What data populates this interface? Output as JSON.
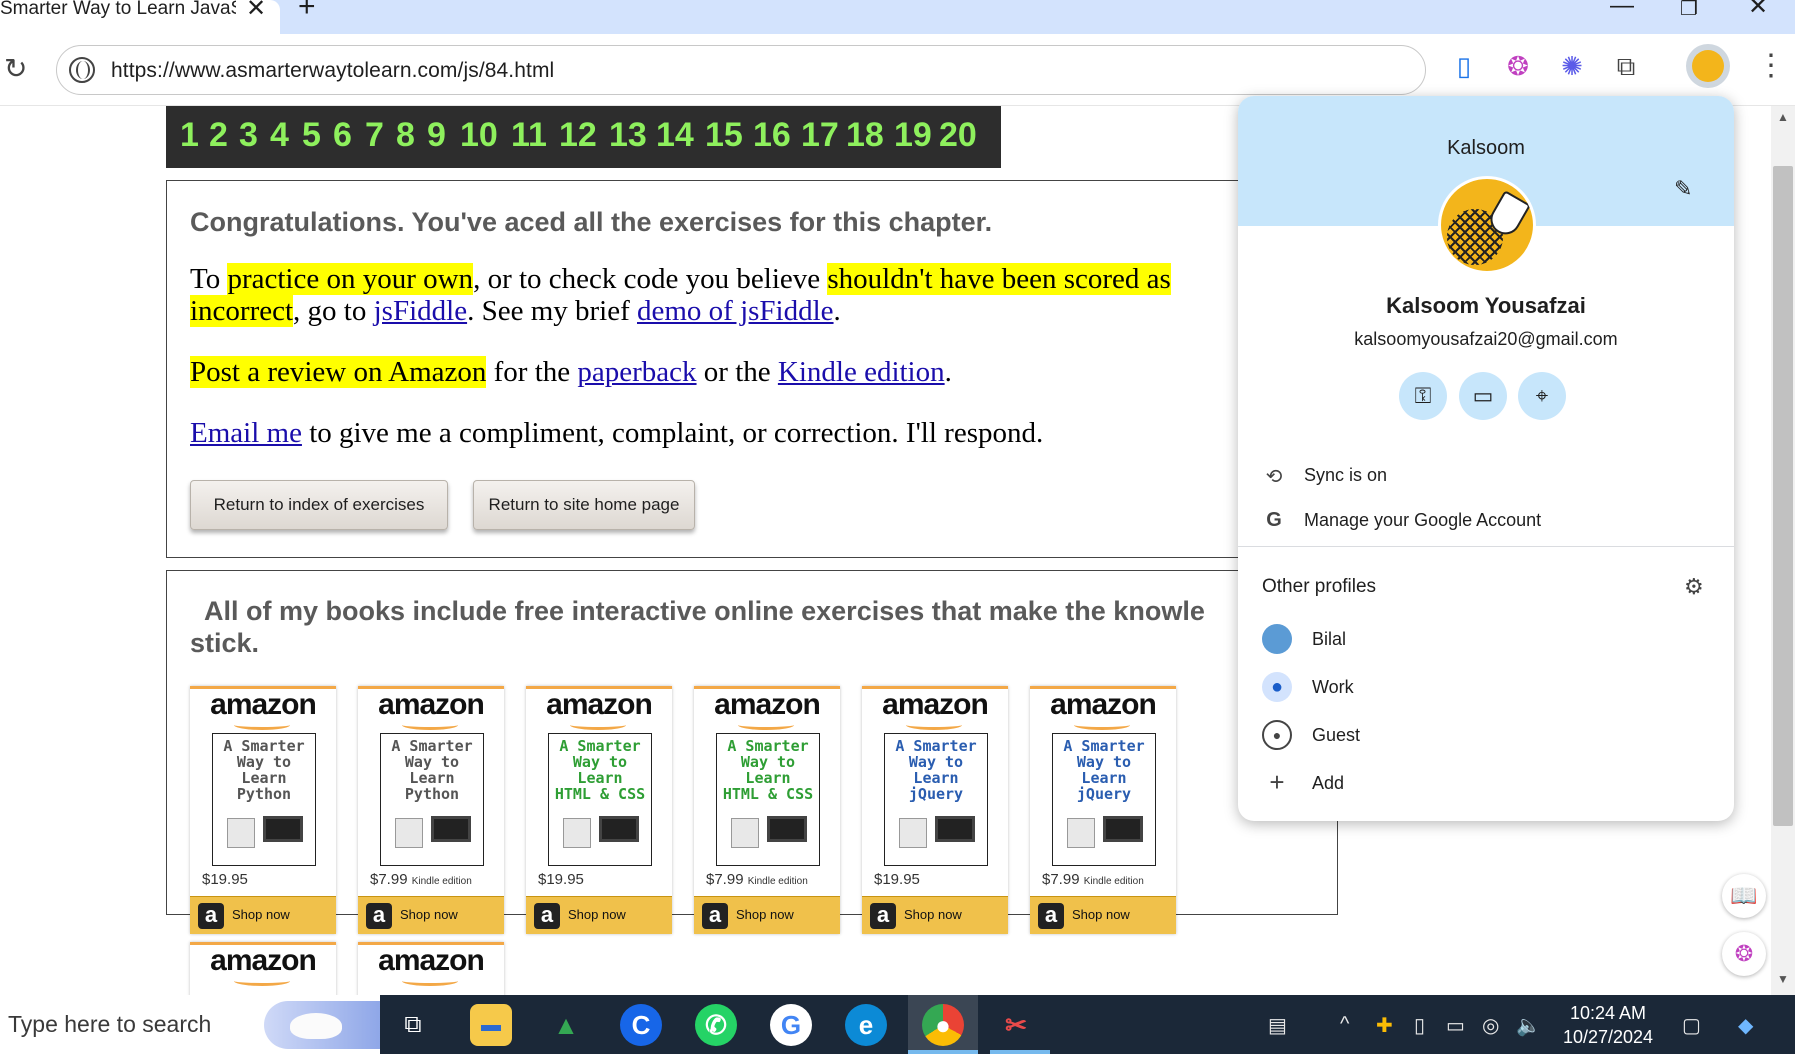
{
  "browser": {
    "tab_title": "Smarter Way to Learn JavaScr",
    "url": "https://www.asmarterwaytolearn.com/js/84.html"
  },
  "page": {
    "nav_numbers": [
      "1",
      "2",
      "3",
      "4",
      "5",
      "6",
      "7",
      "8",
      "9",
      "10",
      "11",
      "12",
      "13",
      "14",
      "15",
      "16",
      "17",
      "18",
      "19",
      "20"
    ],
    "congrats": "Congratulations. You've aced all the exercises for this chapter.",
    "p1": {
      "t1": "To ",
      "h1": "practice on your own",
      "t2": ", or to check code you believe ",
      "h2": "shouldn't have been scored as",
      "h3": "incorrect",
      "t3": ", go to ",
      "link1": "jsFiddle",
      "t4": ". See my brief ",
      "link2": "demo of jsFiddle",
      "t5": "."
    },
    "p2": {
      "h1": "Post a review on Amazon",
      "t1": " for the ",
      "link1": "paperback",
      "t2": " or the ",
      "link2": "Kindle edition",
      "t3": "."
    },
    "p3": {
      "link1": "Email me",
      "t1": " to give me a compliment, complaint, or correction. I'll respond."
    },
    "buttons": {
      "index": "Return to index of exercises",
      "home": "Return to site home page"
    },
    "books_heading_line1": "All of my books include free interactive online exercises that make the knowle",
    "books_heading_line2": "stick.",
    "books": [
      {
        "cover": "A Smarter\nWay to\nLearn\nPython",
        "cover_color": "#555555",
        "price": "$19.95",
        "edition": "",
        "shop": "Shop now"
      },
      {
        "cover": "A Smarter\nWay to\nLearn\nPython",
        "cover_color": "#555555",
        "price": "$7.99",
        "edition": "Kindle edition",
        "shop": "Shop now"
      },
      {
        "cover": "A Smarter\nWay to\nLearn\nHTML & CSS",
        "cover_color": "#2e9e34",
        "price": "$19.95",
        "edition": "",
        "shop": "Shop now"
      },
      {
        "cover": "A Smarter\nWay to\nLearn\nHTML & CSS",
        "cover_color": "#2e9e34",
        "price": "$7.99",
        "edition": "Kindle edition",
        "shop": "Shop now"
      },
      {
        "cover": "A Smarter\nWay to\nLearn\njQuery",
        "cover_color": "#2a5db0",
        "price": "$19.95",
        "edition": "",
        "shop": "Shop now"
      },
      {
        "cover": "A Smarter\nWay to\nLearn\njQuery",
        "cover_color": "#2a5db0",
        "price": "$7.99",
        "edition": "Kindle edition",
        "shop": "Shop now"
      }
    ],
    "amazon_logo": "amazon"
  },
  "profile_popup": {
    "name_top": "Kalsoom",
    "full_name": "Kalsoom Yousafzai",
    "email": "kalsoomyousafzai20@gmail.com",
    "sync": "Sync is on",
    "manage": "Manage your Google Account",
    "other_profiles": "Other profiles",
    "profiles": [
      "Bilal",
      "Work",
      "Guest",
      "Add"
    ]
  },
  "taskbar": {
    "search_placeholder": "Type here to search",
    "time": "10:24 AM",
    "date": "10/27/2024"
  },
  "colors": {
    "nav_green": "#8ef05d",
    "highlight": "#ffff00",
    "link": "#1a0dab",
    "popup_accent": "#c7e6fb"
  }
}
